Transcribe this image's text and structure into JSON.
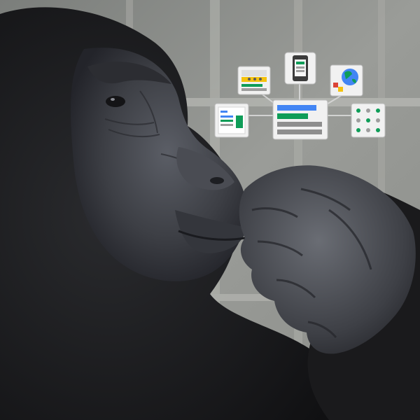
{
  "scene": {
    "subject": "gorilla",
    "background": "cage",
    "colors": {
      "fur": "#1c1c1d",
      "skin": "#3b3d42",
      "skin_highlight": "#5d6068",
      "backdrop": "#8a8c89",
      "bars": "#b7b8b2"
    }
  },
  "icons": {
    "center": {
      "icon": "search-results-panel-icon",
      "colors": [
        "#4285f4",
        "#0f9d58",
        "#9e9e9e"
      ]
    },
    "top_left": {
      "icon": "browser-window-icon",
      "colors": [
        "#f4c20d",
        "#0f9d58"
      ]
    },
    "top_center": {
      "icon": "mobile-phone-icon",
      "colors": [
        "#0f9d58"
      ]
    },
    "top_right": {
      "icon": "globe-icon",
      "colors": [
        "#4285f4",
        "#0f9d58",
        "#db4437",
        "#f4c20d"
      ]
    },
    "left": {
      "icon": "web-page-icon",
      "colors": [
        "#4285f4",
        "#0f9d58"
      ]
    },
    "right": {
      "icon": "people-grid-icon",
      "colors": [
        "#0f9d58",
        "#9e9e9e"
      ]
    }
  }
}
